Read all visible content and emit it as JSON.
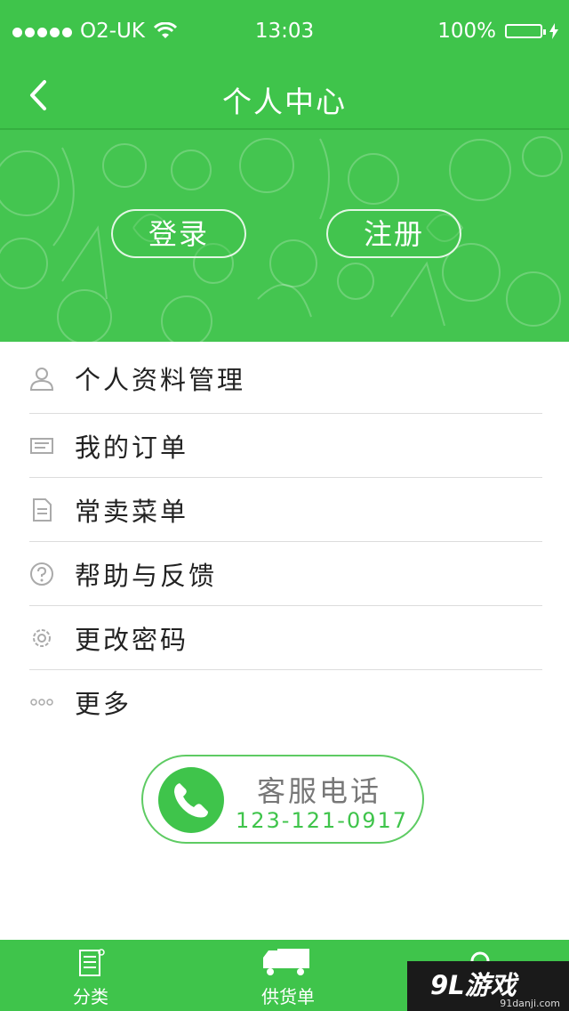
{
  "status_bar": {
    "carrier": "O2-UK",
    "time": "13:03",
    "battery": "100%"
  },
  "nav": {
    "title": "个人中心"
  },
  "banner": {
    "login": "登录",
    "register": "注册"
  },
  "menu": [
    {
      "label": "个人资料管理",
      "icon": "person-icon"
    },
    {
      "label": "我的订单",
      "icon": "order-icon"
    },
    {
      "label": "常卖菜单",
      "icon": "document-icon"
    },
    {
      "label": "帮助与反馈",
      "icon": "help-icon"
    },
    {
      "label": "更改密码",
      "icon": "gear-icon"
    },
    {
      "label": "更多",
      "icon": "more-icon"
    }
  ],
  "service": {
    "title": "客服电话",
    "number": "123-121-0917"
  },
  "tabs": [
    {
      "label": "分类",
      "icon": "list-icon"
    },
    {
      "label": "供货单",
      "icon": "truck-icon"
    },
    {
      "label": "",
      "icon": "search-icon"
    }
  ],
  "watermark": {
    "main": "9L游戏",
    "sub": "91danji.com"
  },
  "colors": {
    "brand_green": "#3fc44b",
    "separator": "#dcdcdc",
    "text": "#222222",
    "muted": "#777777"
  }
}
